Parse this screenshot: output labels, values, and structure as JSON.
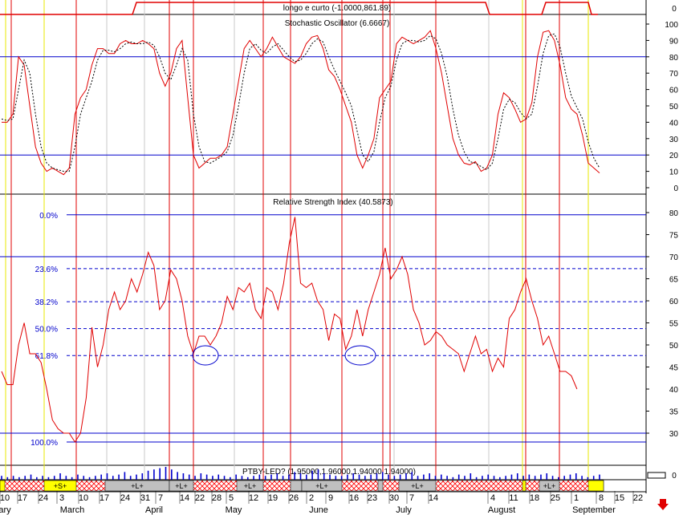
{
  "chart_data": [
    {
      "type": "line",
      "title": "longo e curto (-1.0000,861.89)",
      "yticks": [
        0
      ],
      "series": [
        {
          "values_note": "",
          "values": [
            0
          ]
        }
      ]
    },
    {
      "type": "line",
      "title": "Stochastic Oscillator (6.6667)",
      "ylim": [
        0,
        100
      ],
      "yticks": [
        0,
        10,
        20,
        30,
        40,
        50,
        60,
        70,
        80,
        90,
        100
      ],
      "levels": [
        20,
        80
      ],
      "series": [
        {
          "style": "solid",
          "color": "#e00000",
          "values": [
            40,
            40,
            45,
            80,
            75,
            50,
            25,
            15,
            10,
            12,
            10,
            8,
            12,
            45,
            55,
            60,
            75,
            85,
            85,
            82,
            82,
            88,
            90,
            88,
            88,
            90,
            88,
            85,
            70,
            62,
            70,
            85,
            90,
            55,
            20,
            12,
            15,
            18,
            18,
            20,
            25,
            45,
            65,
            85,
            90,
            85,
            80,
            85,
            92,
            86,
            80,
            78,
            76,
            80,
            88,
            92,
            93,
            85,
            72,
            68,
            60,
            50,
            40,
            20,
            12,
            20,
            30,
            55,
            60,
            65,
            88,
            92,
            90,
            88,
            90,
            92,
            96,
            85,
            70,
            50,
            30,
            20,
            15,
            14,
            16,
            10,
            12,
            20,
            45,
            58,
            55,
            48,
            40,
            42,
            52,
            80,
            95,
            96,
            90,
            75,
            55,
            48,
            45,
            32,
            15,
            12,
            9
          ]
        },
        {
          "style": "dotted",
          "color": "#000000",
          "values": [
            42,
            41,
            42,
            60,
            78,
            70,
            45,
            25,
            15,
            12,
            11,
            10,
            10,
            25,
            45,
            55,
            65,
            78,
            84,
            84,
            83,
            85,
            88,
            89,
            88,
            88,
            89,
            87,
            80,
            70,
            66,
            75,
            85,
            78,
            45,
            25,
            16,
            15,
            17,
            19,
            22,
            32,
            50,
            70,
            85,
            88,
            84,
            82,
            86,
            88,
            84,
            80,
            77,
            78,
            82,
            88,
            91,
            89,
            80,
            72,
            65,
            58,
            50,
            35,
            20,
            16,
            22,
            40,
            55,
            62,
            78,
            88,
            90,
            90,
            89,
            90,
            93,
            91,
            82,
            68,
            48,
            32,
            22,
            16,
            15,
            13,
            11,
            15,
            30,
            48,
            54,
            52,
            46,
            42,
            45,
            62,
            82,
            93,
            94,
            86,
            70,
            56,
            49,
            42,
            28,
            18,
            12
          ]
        }
      ]
    },
    {
      "type": "line",
      "title": "Relative Strength Index (40.5873)",
      "ylim": [
        28,
        82
      ],
      "yticks": [
        30,
        35,
        40,
        45,
        50,
        55,
        60,
        65,
        70,
        75,
        80
      ],
      "levels": [
        30,
        70
      ],
      "fib_levels": [
        {
          "label": "0.0%",
          "value": 79.5
        },
        {
          "label": "23.6%",
          "value": 67.3
        },
        {
          "label": "38.2%",
          "value": 59.8
        },
        {
          "label": "50.0%",
          "value": 53.7
        },
        {
          "label": "61.8%",
          "value": 47.6
        },
        {
          "label": "100.0%",
          "value": 28
        }
      ],
      "series": [
        {
          "name": "",
          "color": "#e00000",
          "values": [
            44,
            41,
            41,
            50,
            55,
            48,
            48,
            46,
            40,
            33,
            31,
            30,
            30,
            28,
            30,
            38,
            54,
            45,
            50,
            58,
            62,
            58,
            60,
            65,
            62,
            66,
            71,
            68,
            58,
            60,
            67,
            65,
            60,
            52,
            48,
            52,
            52,
            50,
            52,
            55,
            61,
            58,
            63,
            62,
            64,
            58,
            56,
            63,
            62,
            58,
            64,
            73,
            79,
            64,
            63,
            64,
            60,
            58,
            51,
            57,
            56,
            49,
            52,
            58,
            52,
            58,
            62,
            66,
            72,
            65,
            67,
            70,
            66,
            58,
            55,
            50,
            51,
            53,
            52,
            50,
            49,
            48,
            44,
            48,
            52,
            48,
            49,
            44,
            47,
            45,
            56,
            58,
            62,
            65,
            60,
            56,
            50,
            52,
            48,
            44,
            44,
            43,
            40
          ]
        }
      ]
    },
    {
      "type": "bar",
      "title": "PTBY-LED? (1.95000,1.96000,1.94000,1.94000)",
      "yticks": [
        0
      ],
      "series": [
        {
          "name": "",
          "color": "#0000cc",
          "values": [
            3,
            2,
            3,
            2,
            3,
            4,
            2,
            3,
            2,
            3,
            5,
            3,
            2,
            4,
            3,
            2,
            3,
            4,
            5,
            3,
            4,
            6,
            3,
            4,
            5,
            7,
            8,
            9,
            10,
            8,
            6,
            5,
            4,
            3,
            5,
            4,
            3,
            4,
            3,
            2,
            4,
            3,
            2,
            3,
            4,
            3,
            4,
            5,
            3,
            4,
            6,
            5,
            4,
            7,
            8,
            5,
            4,
            3,
            3,
            4,
            5,
            4,
            3,
            4,
            5,
            6,
            4,
            3,
            4,
            5,
            6,
            3,
            4,
            5,
            3,
            4,
            3,
            2,
            4,
            3,
            5,
            2,
            3,
            4,
            3,
            2,
            3,
            4,
            5,
            3,
            4,
            3,
            4,
            5,
            3,
            2,
            3,
            4,
            5,
            3,
            2,
            3,
            4
          ]
        }
      ]
    }
  ],
  "months": {
    "row1": [
      "10",
      "17",
      "24",
      "3",
      "10",
      "17",
      "24",
      "31",
      "7",
      "14",
      "22",
      "28",
      "5",
      "12",
      "19",
      "26",
      "2",
      "9",
      "16",
      "23",
      "30",
      "7",
      "14",
      "4",
      "11",
      "18",
      "25",
      "1",
      "8",
      "15",
      "22"
    ],
    "row2": [
      "ary",
      "March",
      "April",
      "May",
      "June",
      "July",
      "August",
      "September"
    ]
  },
  "signals": {
    "labels": [
      "+S+",
      "+L+",
      "+L+",
      "+L+",
      "+L+",
      "+L+",
      "+L+"
    ]
  },
  "colors": {
    "price_line": "#e00000",
    "level_line": "#0000cc",
    "signal_s": "#ffff00",
    "signal_l": "#c0c0c0",
    "signal_hatch": "#ff0000"
  }
}
